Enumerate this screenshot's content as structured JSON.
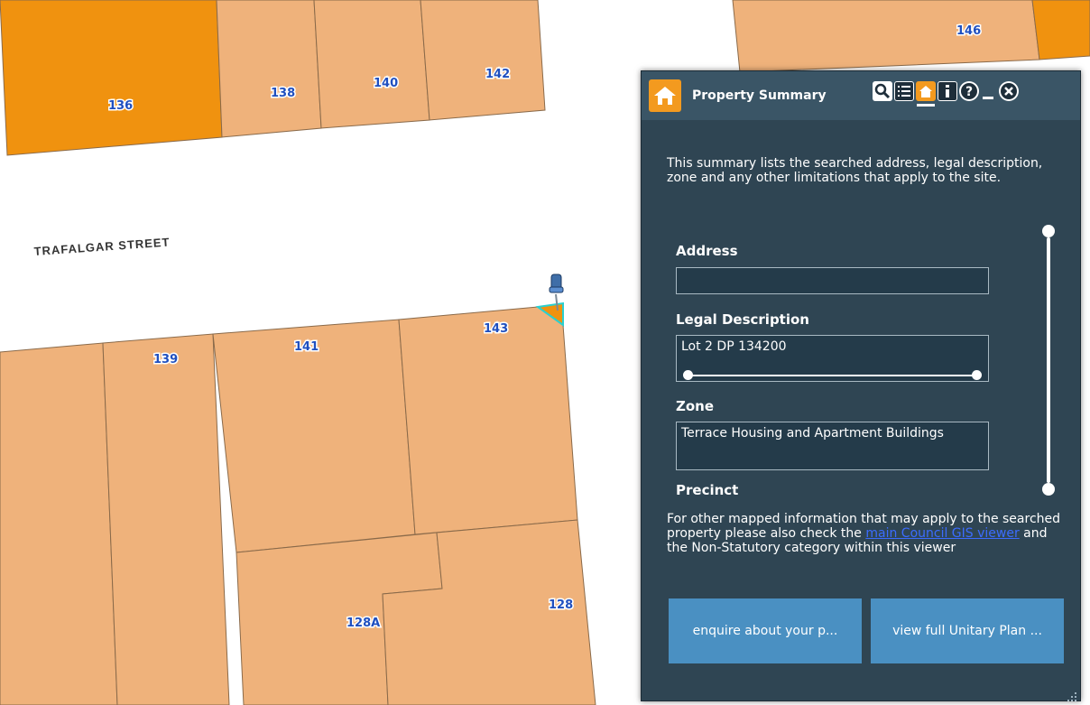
{
  "map": {
    "street_name": "TRAFALGAR STREET",
    "lots": [
      "136",
      "138",
      "140",
      "142",
      "146",
      "139",
      "141",
      "143",
      "128A",
      "128"
    ]
  },
  "panel": {
    "title": "Property Summary",
    "intro": "This summary lists the searched address, legal description, zone and any other limitations that apply to the site.",
    "fields": {
      "address_label": "Address",
      "address_value": "",
      "legal_label": "Legal Description",
      "legal_value": "Lot 2 DP 134200",
      "zone_label": "Zone",
      "zone_value": "Terrace Housing and Apartment Buildings",
      "precinct_label": "Precinct"
    },
    "footer_before": "For other mapped information that may apply to the searched property please also check the ",
    "footer_link": "main Council GIS viewer",
    "footer_after": " and the Non-Statutory category within this viewer",
    "buttons": {
      "enquire": "enquire about your p...",
      "unitary": "view full Unitary Plan ..."
    },
    "toolbar_icons": [
      "search-icon",
      "list-icon",
      "home-icon",
      "info-icon",
      "help-icon",
      "minimize-icon",
      "close-icon"
    ]
  },
  "colors": {
    "parcel": "#efb27b",
    "parcel_selected": "#f0920f",
    "panel_bg": "#2f4553",
    "accent": "#f39a1f",
    "button": "#4a90c2"
  }
}
